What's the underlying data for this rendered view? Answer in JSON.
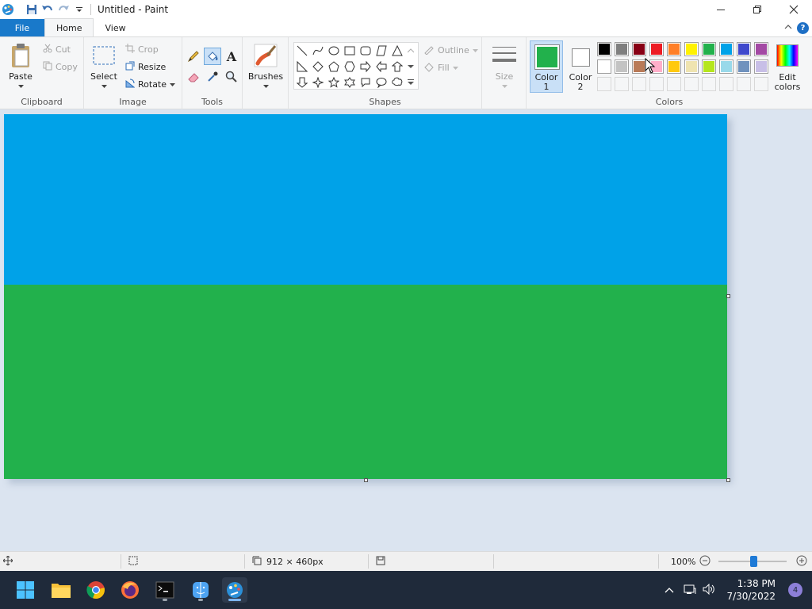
{
  "window": {
    "title": "Untitled - Paint"
  },
  "tabs": {
    "file": "File",
    "home": "Home",
    "view": "View"
  },
  "help_glyph": "?",
  "ribbon": {
    "clipboard": {
      "label": "Clipboard",
      "paste": "Paste",
      "cut": "Cut",
      "copy": "Copy"
    },
    "image": {
      "label": "Image",
      "select": "Select",
      "crop": "Crop",
      "resize": "Resize",
      "rotate": "Rotate"
    },
    "tools": {
      "label": "Tools",
      "text_glyph": "A"
    },
    "brushes": {
      "label": "Brushes"
    },
    "shapes": {
      "label": "Shapes",
      "outline": "Outline",
      "fill": "Fill"
    },
    "size": {
      "label": "Size"
    },
    "colors": {
      "label": "Colors",
      "color1_label": "Color 1",
      "color2_label": "Color 2",
      "color1_line1": "Color",
      "color1_line2": "1",
      "color2_line1": "Color",
      "color2_line2": "2",
      "edit_line1": "Edit",
      "edit_line2": "colors",
      "color1_value": "#22b14c",
      "color2_value": "#ffffff",
      "palette_row1": [
        "#000000",
        "#7f7f7f",
        "#880015",
        "#ed1c24",
        "#ff7f27",
        "#fff200",
        "#22b14c",
        "#00a2e8",
        "#3f48cc",
        "#a349a4"
      ],
      "palette_row2": [
        "#ffffff",
        "#c3c3c3",
        "#b97a57",
        "#ffaec9",
        "#ffc90e",
        "#efe4b0",
        "#b5e61d",
        "#99d9ea",
        "#7092be",
        "#c8bfe7"
      ],
      "palette_row3": [
        "",
        "",
        "",
        "",
        "",
        "",
        "",
        "",
        "",
        ""
      ]
    }
  },
  "canvas": {
    "top_color": "#00a2e8",
    "bottom_color": "#22b14c"
  },
  "status": {
    "dimensions": "912 × 460px",
    "zoom": "100%"
  },
  "taskbar": {
    "time": "1:38 PM",
    "date": "7/30/2022",
    "notifications": "4"
  }
}
